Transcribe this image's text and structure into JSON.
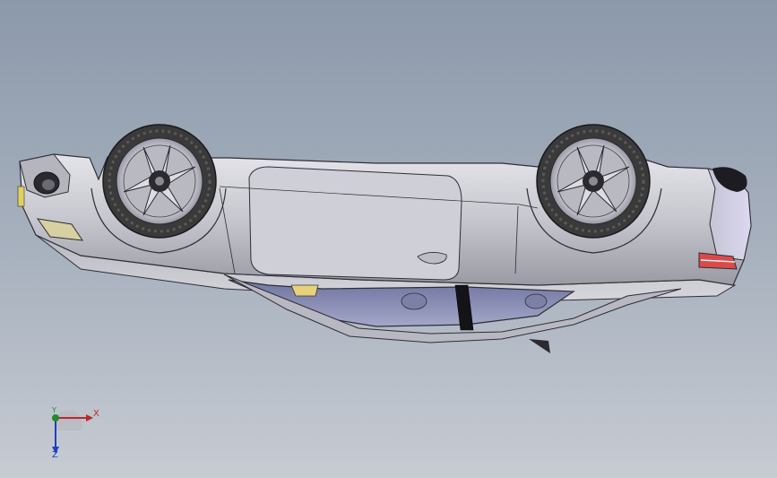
{
  "viewport": {
    "background_top": "#8c99ab",
    "background_bottom": "#c7cbd2"
  },
  "model": {
    "body_color": "#c9c9d0",
    "outline_color": "#2e2e36",
    "glass_color": "#8f93b8",
    "tire_color": "#3a3a3a",
    "rim_color": "#d9d9df"
  },
  "triad": {
    "x_label": "X",
    "y_label": "Y",
    "z_label": "Z",
    "x_color": "#c0262b",
    "y_color": "#1f8b2a",
    "z_color": "#1e3fc0"
  }
}
